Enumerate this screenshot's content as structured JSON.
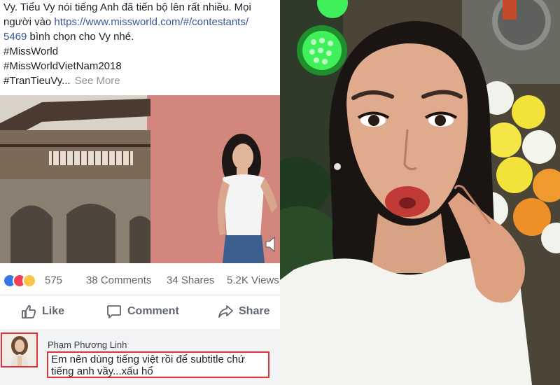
{
  "post": {
    "text_line1": "Vy. Tiểu Vy nói tiếng Anh đã tiến bộ lên rất nhiều. Mọi",
    "text_line2_prefix": "người vào ",
    "text_line2_link": "https://www.missworld.com/#/contestants/",
    "text_line3_link": "5469",
    "text_line3_suffix": " bình chọn cho Vy nhé.",
    "hashtag1": "#MissWorld",
    "hashtag2": "#MissWorldVietNam2018",
    "hashtag3": "#TranTieuVy...",
    "see_more": "See More"
  },
  "stats": {
    "reactions": "575",
    "comments": "38 Comments",
    "shares": "34 Shares",
    "views": "5.2K Views"
  },
  "actions": {
    "like": "Like",
    "comment": "Comment",
    "share": "Share"
  },
  "comment": {
    "author": "Phạm Phương Linh",
    "line1": "Em nên dùng tiếng việt rồi để subtitle chứ",
    "line2": "tiếng anh vầy...xấu hổ"
  },
  "colors": {
    "link": "#385898",
    "highlight_border": "#e0343a",
    "like_blue": "#3578e5"
  }
}
